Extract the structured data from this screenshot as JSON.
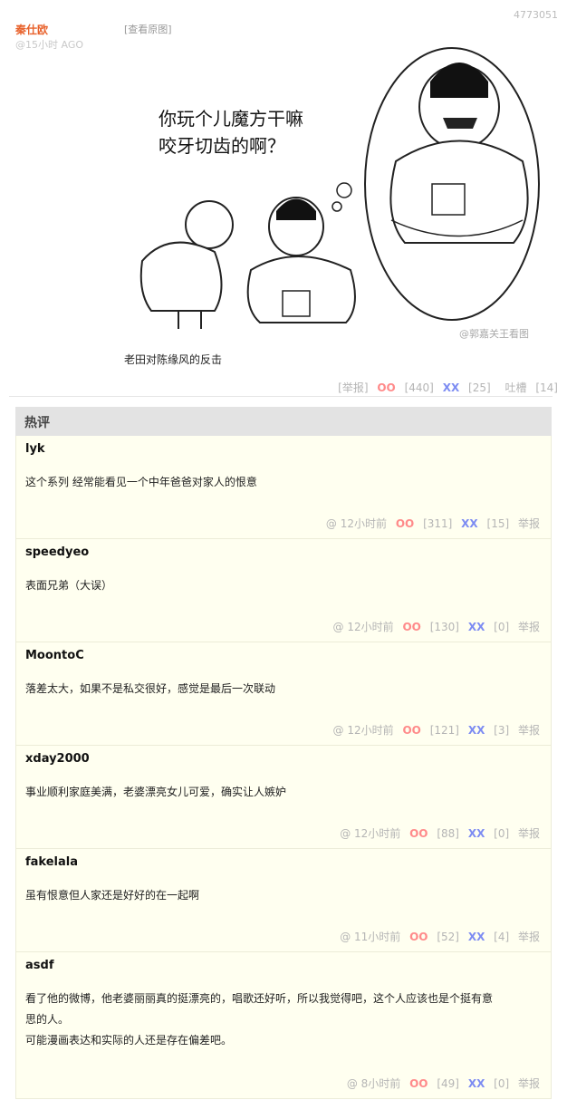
{
  "post": {
    "id": "4773051",
    "author": "秦仕欧",
    "time": "@15小时 AGO",
    "view_original": "[查看原图]",
    "caption": "老田对陈缘风的反击",
    "comic_text": {
      "line1": "你玩个儿魔方干嘛",
      "line2": "咬牙切齿的啊？",
      "watermark": "@郭嘉关王看图"
    },
    "actions": {
      "report": "[举报]",
      "oo_label": "OO",
      "oo_count": "[440]",
      "xx_label": "XX",
      "xx_count": "[25]",
      "tucao_label": "吐槽",
      "tucao_count": "[14]"
    }
  },
  "hot_title": "热评",
  "comments": [
    {
      "author": "lyk",
      "text": "这个系列 经常能看见一个中年爸爸对家人的恨意",
      "time": "@  12小时前",
      "oo": "[311]",
      "xx": "[15]",
      "report": "举报"
    },
    {
      "author": "speedyeo",
      "text": "表面兄弟（大误）",
      "time": "@  12小时前",
      "oo": "[130]",
      "xx": "[0]",
      "report": "举报"
    },
    {
      "author": "MoontoC",
      "text": "落差太大，如果不是私交很好，感觉是最后一次联动",
      "time": "@  12小时前",
      "oo": "[121]",
      "xx": "[3]",
      "report": "举报"
    },
    {
      "author": "xday2000",
      "text": "事业顺利家庭美满，老婆漂亮女儿可爱，确实让人嫉妒",
      "time": "@  12小时前",
      "oo": "[88]",
      "xx": "[0]",
      "report": "举报"
    },
    {
      "author": "fakelala",
      "text": "虽有恨意但人家还是好好的在一起啊",
      "time": "@  11小时前",
      "oo": "[52]",
      "xx": "[4]",
      "report": "举报"
    },
    {
      "author": "asdf",
      "text_line1": "看了他的微博，他老婆丽丽真的挺漂亮的，唱歌还好听，所以我觉得吧，这个人应该也是个挺有意",
      "text_line2": "思的人。",
      "text_line3": "可能漫画表达和实际的人还是存在偏差吧。",
      "time": "@  8小时前",
      "oo": "[49]",
      "xx": "[0]",
      "report": "举报"
    }
  ],
  "labels": {
    "oo": "OO",
    "xx": "XX"
  }
}
